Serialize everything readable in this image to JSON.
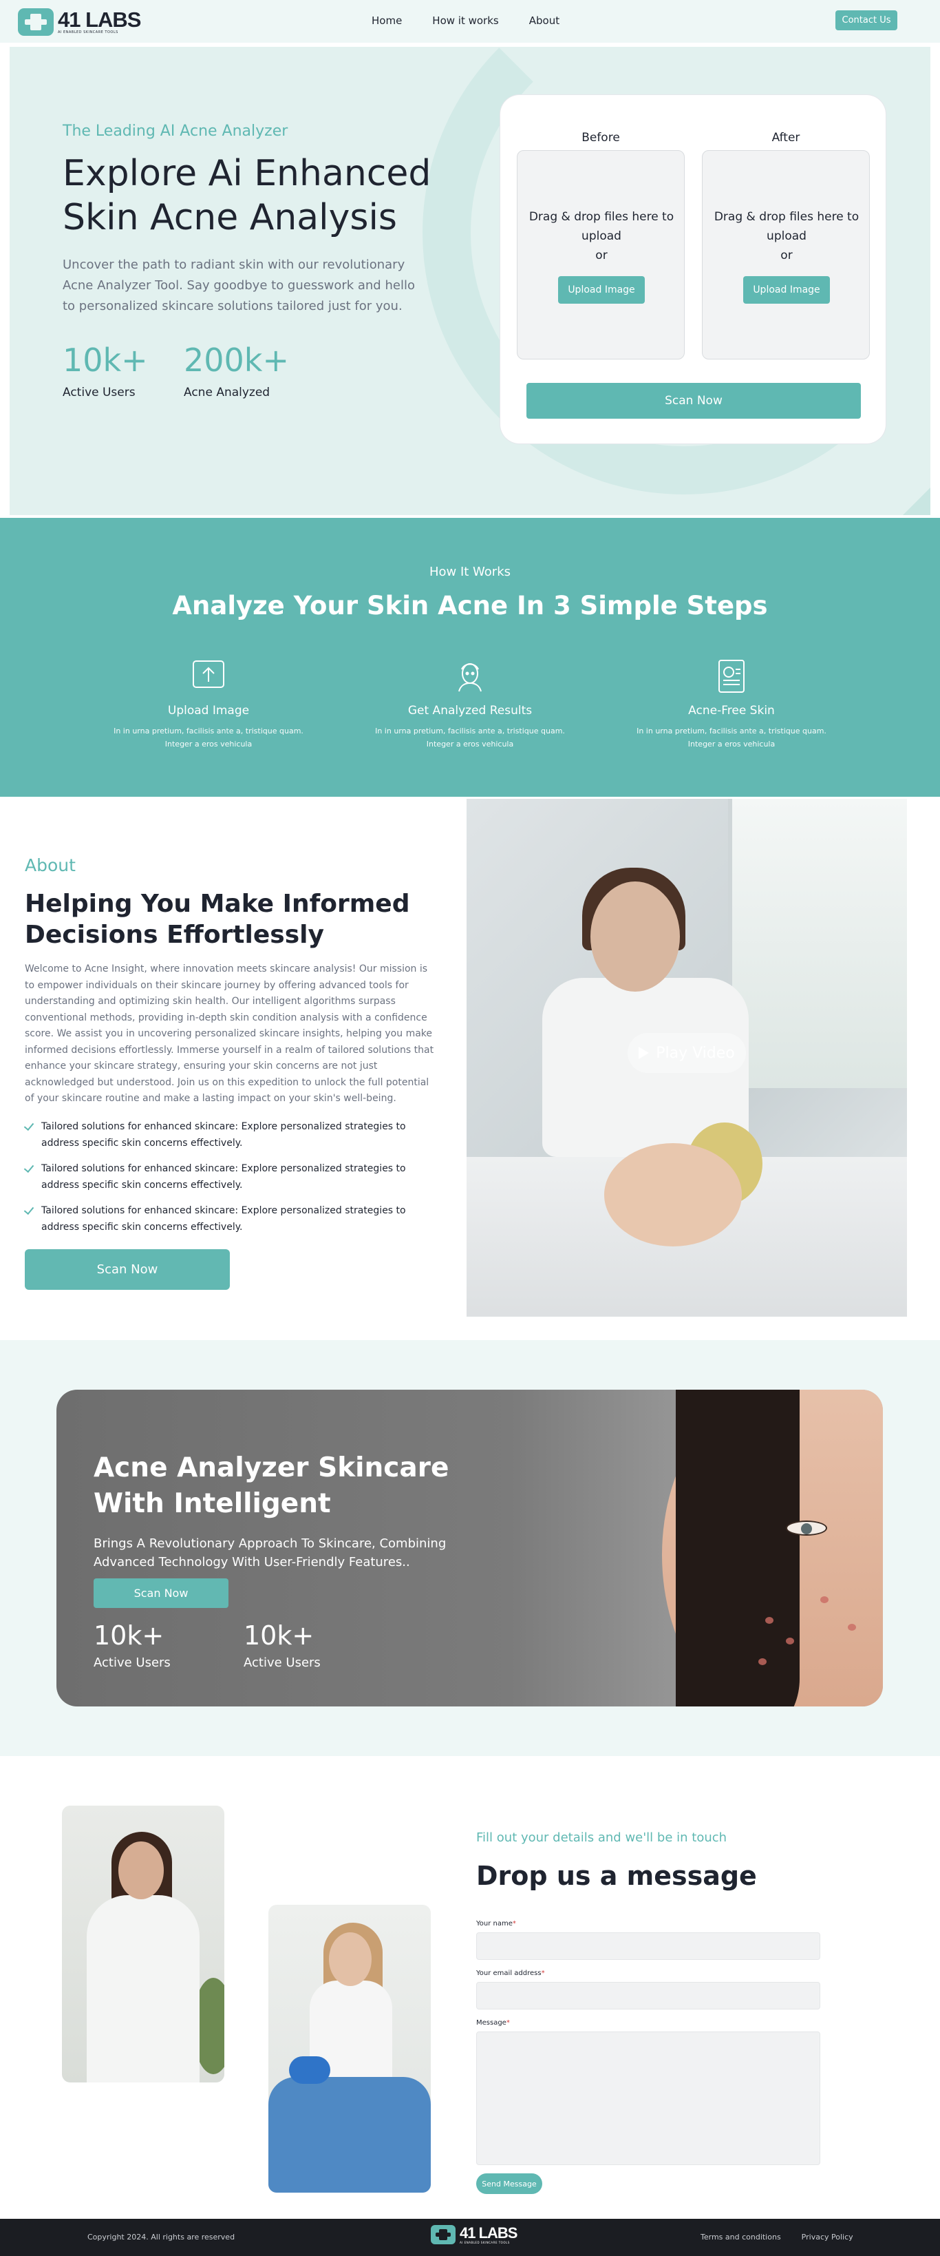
{
  "nav": {
    "logo_name": "41 LABS",
    "logo_tagline": "AI ENABLED SKINCARE TOOLS",
    "links": [
      "Home",
      "How it works",
      "About"
    ],
    "contact_label": "Contact Us"
  },
  "hero": {
    "eyebrow": "The Leading AI Acne Analyzer",
    "title": "Explore Ai Enhanced Skin Acne Analysis",
    "description": "Uncover the path to radiant skin with our revolutionary Acne Analyzer Tool. Say goodbye to guesswork and hello to personalized skincare solutions tailored just for you.",
    "stats": [
      {
        "value": "10k+",
        "label": "Active Users"
      },
      {
        "value": "200k+",
        "label": "Acne Analyzed"
      }
    ]
  },
  "upload_card": {
    "before_label": "Before",
    "after_label": "After",
    "drop_text_line1": "Drag & drop files here to upload",
    "drop_text_line2": "or",
    "upload_button": "Upload Image",
    "scan_button": "Scan Now"
  },
  "how_it_works": {
    "eyebrow": "How It Works",
    "title": "Analyze Your Skin Acne In 3 Simple Steps",
    "steps": [
      {
        "icon": "upload-icon",
        "title": "Upload Image",
        "desc": "In in urna pretium, facilisis ante a, tristique quam. Integer a eros vehicula"
      },
      {
        "icon": "face-analysis-icon",
        "title": "Get Analyzed Results",
        "desc": "In in urna pretium, facilisis ante a, tristique quam. Integer a eros vehicula"
      },
      {
        "icon": "report-icon",
        "title": "Acne-Free Skin",
        "desc": "In in urna pretium, facilisis ante a, tristique quam. Integer a eros vehicula"
      }
    ]
  },
  "about": {
    "eyebrow": "About",
    "title": "Helping You Make Informed Decisions Effortlessly",
    "description": "Welcome to Acne Insight, where innovation meets skincare analysis! Our mission is to empower individuals on their skincare journey by offering advanced tools for understanding and optimizing skin health. Our intelligent algorithms surpass conventional methods, providing in-depth skin condition analysis with a confidence score. We assist you in uncovering personalized skincare insights, helping you make informed decisions effortlessly. Immerse yourself in a realm of tailored solutions that enhance your skincare strategy, ensuring your skin concerns are not just acknowledged but understood. Join us on this expedition to unlock the full potential of your skincare routine and make a lasting impact on your skin's well-being.",
    "bullets": [
      "Tailored solutions for enhanced skincare: Explore personalized strategies to address specific skin concerns effectively.",
      "Tailored solutions for enhanced skincare: Explore personalized strategies to address specific skin concerns effectively.",
      "Tailored solutions for enhanced skincare: Explore personalized strategies to address specific skin concerns effectively."
    ],
    "scan_button": "Scan Now",
    "play_label": "Play Video"
  },
  "banner": {
    "title": "Acne Analyzer Skincare With Intelligent",
    "description": "Brings A Revolutionary Approach To Skincare, Combining Advanced Technology With User-Friendly Features..",
    "scan_button": "Scan Now",
    "stats": [
      {
        "value": "10k+",
        "label": "Active Users"
      },
      {
        "value": "10k+",
        "label": "Active Users"
      }
    ]
  },
  "contact": {
    "eyebrow": "Fill out your details and we'll be in touch",
    "title": "Drop us a message",
    "name_label": "Your name",
    "email_label": "Your email address",
    "message_label": "Message",
    "required_mark": "*",
    "send_button": "Send Message"
  },
  "footer": {
    "copyright": "Copyright 2024. All rights are reserved",
    "logo_name": "41 LABS",
    "logo_tagline": "AI ENABLED SKINCARE TOOLS",
    "links": [
      "Terms and conditions",
      "Privacy Policy"
    ]
  },
  "colors": {
    "accent": "#5fb8b2",
    "hero_bg": "#e2f1ef",
    "footer_bg": "#1b1d22"
  }
}
